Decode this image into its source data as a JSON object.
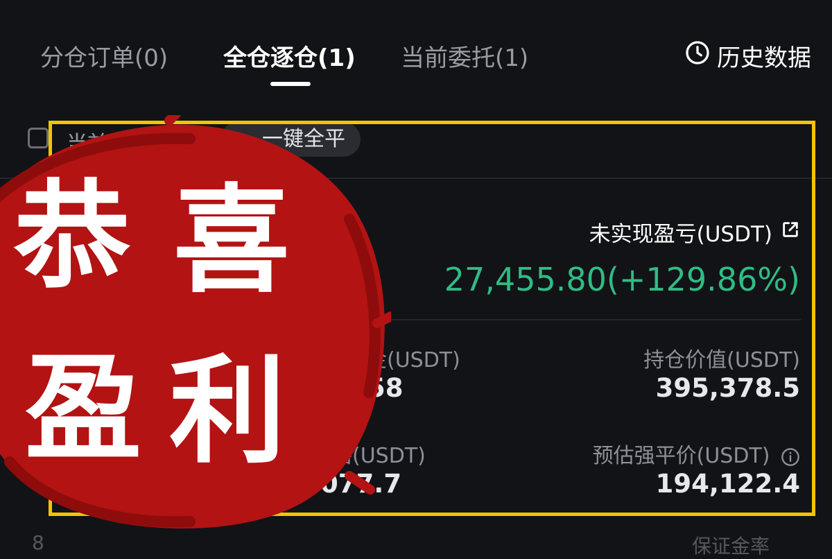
{
  "tabs": [
    {
      "label": "分仓订单(0)"
    },
    {
      "label": "全仓逐仓(1)"
    },
    {
      "label": "当前委托(1)"
    }
  ],
  "history": {
    "label": "历史数据",
    "icon": "clock-icon"
  },
  "toolbar": {
    "current_pair_label": "当前交易对",
    "current_pair_checked": false,
    "close_all_label": "一键全平"
  },
  "position": {
    "unrealized_pnl_label": "未实现盈亏(USDT)",
    "unrealized_pnl_value": "27,455.80(+129.86%)",
    "margin_label_visible": "金(USDT)",
    "margin_value_visible": "58",
    "position_value_label": "持仓价值(USDT)",
    "position_value": "395,378.5",
    "price_label_visible": "格(USDT)",
    "price_value_visible": ".077.7",
    "liq_price_label": "预估强平价(USDT)",
    "liq_price_value": "194,122.4",
    "bottom_left_fragment": "8",
    "bottom_right_fragment": "保证金率"
  },
  "stamp": {
    "chars": [
      "恭",
      "喜",
      "盈",
      "利"
    ]
  },
  "colors": {
    "background": "#121316",
    "profit_green": "#2ebd85",
    "highlight_yellow": "#f5c400",
    "stamp_red": "#b31313"
  }
}
